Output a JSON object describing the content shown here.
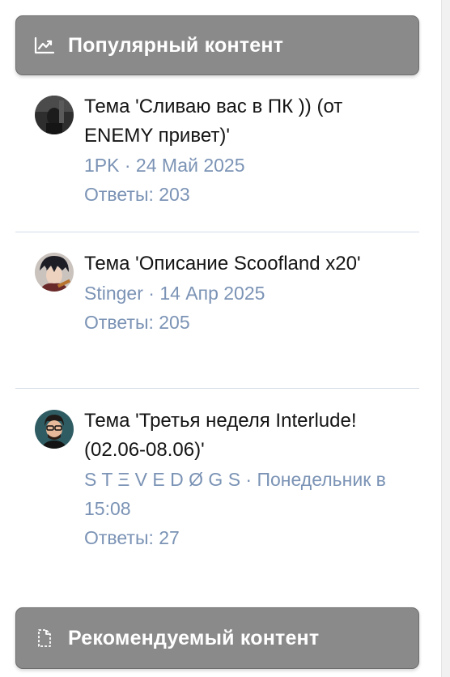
{
  "popular": {
    "header_label": "Популярный контент",
    "header_icon": "trending-chart-icon",
    "items": [
      {
        "title": "Тема 'Сливаю вас в ПК )) (от ENEMY привет)'",
        "meta": "1PK · 24 Май 2025",
        "replies": "Ответы: 203",
        "avatar_color": "#3a3a3a"
      },
      {
        "title": "Тема 'Описание Scoofland x20'",
        "meta": "Stinger · 14 Апр 2025",
        "replies": "Ответы: 205",
        "avatar_color": "#4a3c44"
      },
      {
        "title": "Тема 'Третья неделя Interlude! (02.06-08.06)'",
        "meta": "S T Ξ V E D Ø G S · Понедельник в 15:08",
        "replies": "Ответы: 27",
        "avatar_color": "#2c4a55"
      }
    ]
  },
  "recommended": {
    "header_label": "Рекомендуемый контент",
    "header_icon": "document-icon"
  },
  "colors": {
    "header_bg": "#8a8a8a",
    "meta_text": "#7b93b5",
    "title_text": "#141414",
    "divider": "#d3dbe6"
  }
}
